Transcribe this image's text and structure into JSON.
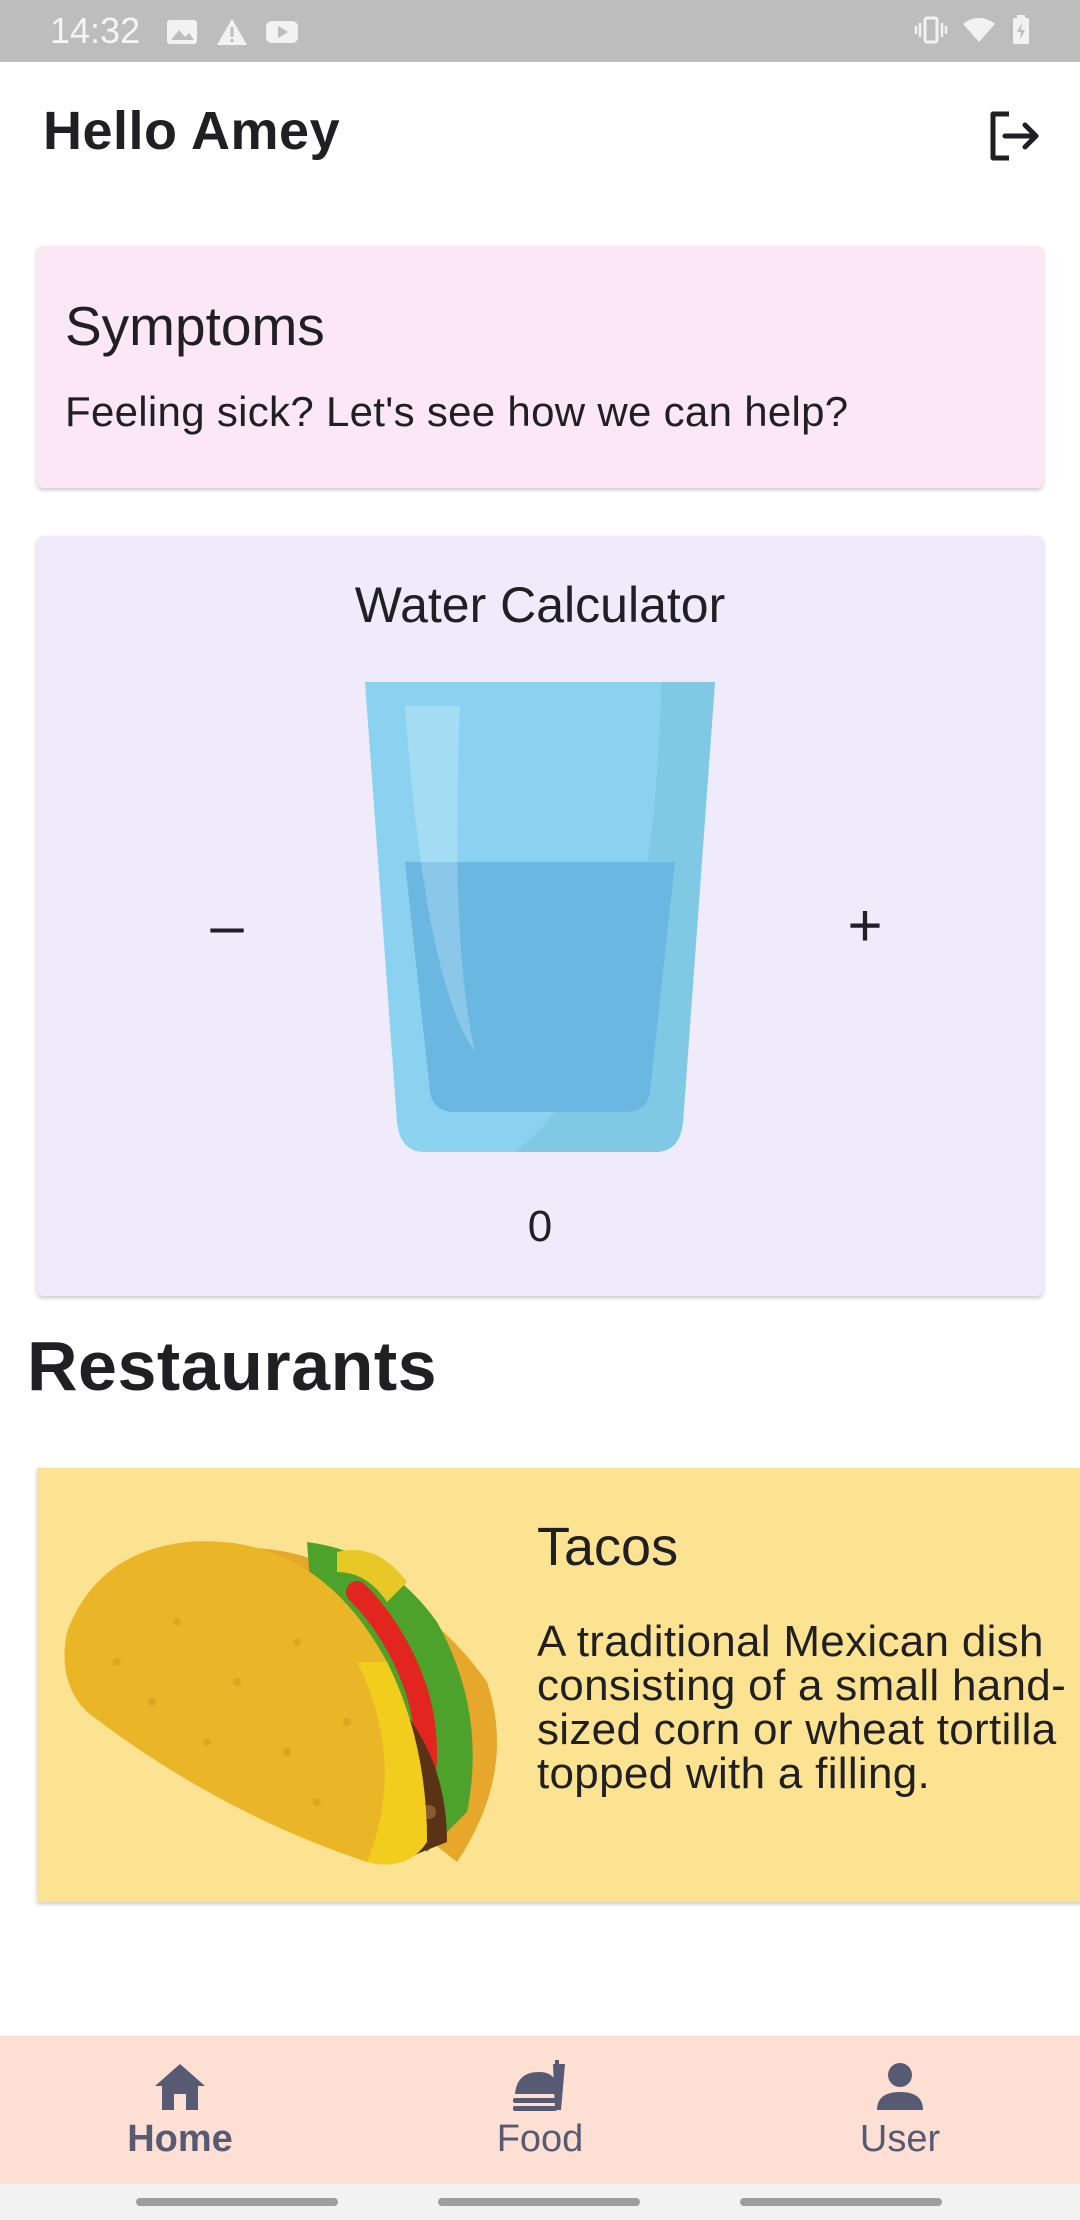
{
  "status_bar": {
    "time": "14:32",
    "left_icons": [
      "image-icon",
      "warning-icon",
      "youtube-icon"
    ],
    "right_icons": [
      "vibrate-icon",
      "wifi-icon",
      "battery-charging-icon"
    ]
  },
  "header": {
    "greeting": "Hello Amey",
    "logout_icon": "logout-icon"
  },
  "symptoms": {
    "title": "Symptoms",
    "text": "Feeling sick? Let's see how we can help?"
  },
  "water": {
    "title": "Water Calculator",
    "minus_label": "–",
    "plus_label": "+",
    "count": "0"
  },
  "restaurants": {
    "heading": "Restaurants",
    "items": [
      {
        "title": "Tacos",
        "description": "A traditional Mexican dish consisting of a small hand-sized corn or wheat tortilla topped with a filling."
      }
    ]
  },
  "bottom_nav": {
    "items": [
      {
        "label": "Home",
        "icon": "home-icon"
      },
      {
        "label": "Food",
        "icon": "food-icon"
      },
      {
        "label": "User",
        "icon": "user-icon"
      }
    ]
  },
  "colors": {
    "symptoms_bg": "#fce7f6",
    "water_bg": "#efebfb",
    "restaurant_bg": "#fce392",
    "nav_bg": "#fde0d3",
    "nav_text": "#565a73"
  }
}
